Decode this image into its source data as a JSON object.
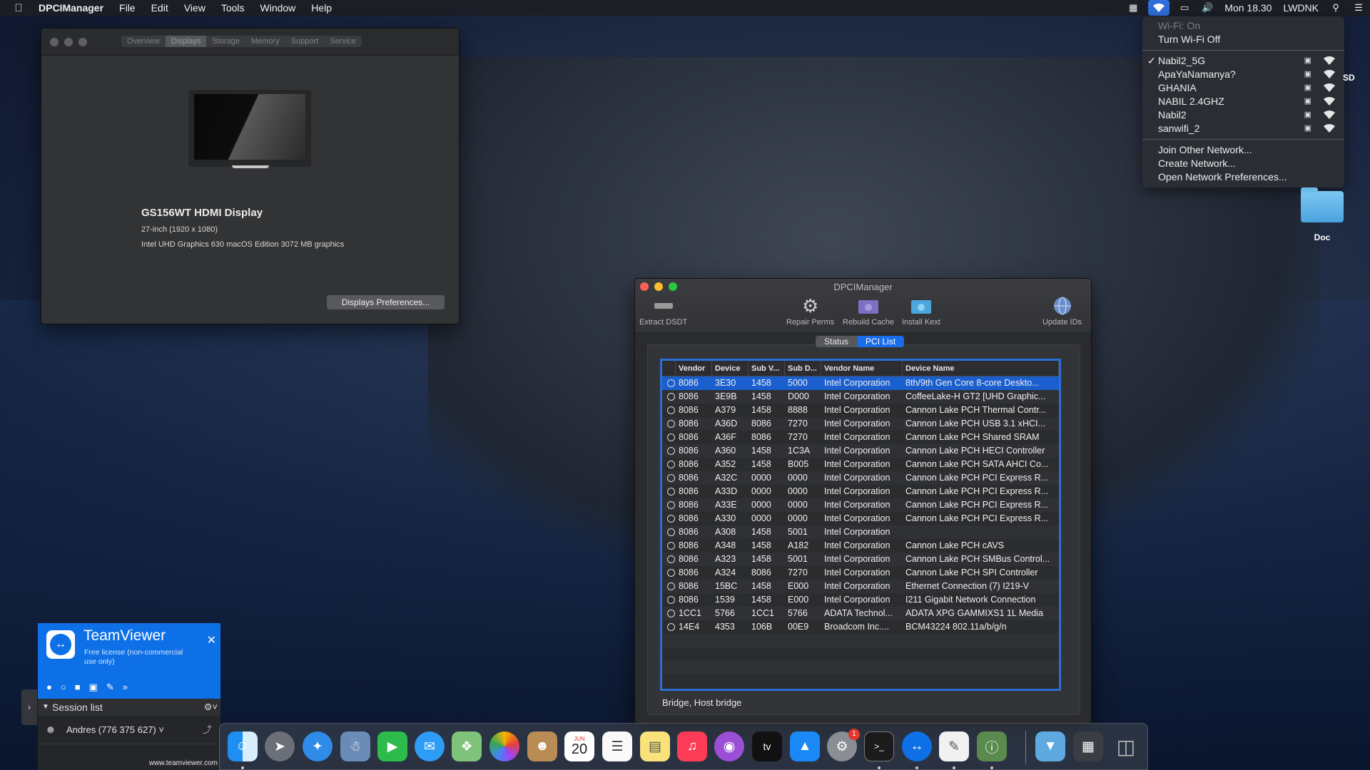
{
  "menubar": {
    "app_name": "DPCIManager",
    "menus": [
      "File",
      "Edit",
      "View",
      "Tools",
      "Window",
      "Help"
    ],
    "clock": "Mon 18.30",
    "user": "LWDNK"
  },
  "wifi_menu": {
    "status": "Wi-Fi: On",
    "toggle": "Turn Wi-Fi Off",
    "networks": [
      "Nabil2_5G",
      "ApaYaNamanya?",
      "GHANIA",
      "NABIL 2.4GHZ",
      "Nabil2",
      "sanwifi_2"
    ],
    "connected_network": "Nabil2_5G",
    "actions": [
      "Join Other Network...",
      "Create Network...",
      "Open Network Preferences..."
    ]
  },
  "desktop": {
    "folder_label": "Doc",
    "partial_label": "SD"
  },
  "about": {
    "tabs": [
      "Overview",
      "Displays",
      "Storage",
      "Memory",
      "Support",
      "Service"
    ],
    "active_tab": "Displays",
    "display_name": "GS156WT HDMI Display",
    "display_size": "27-inch (1920 x 1080)",
    "graphics": "Intel UHD Graphics 630 macOS Edition 3072 MB graphics",
    "button": "Displays Preferences..."
  },
  "dpci": {
    "title": "DPCIManager",
    "toolbar": [
      {
        "label": "Extract DSDT",
        "icon": "chip-icon"
      },
      {
        "label": "Repair Perms",
        "icon": "gear-icon"
      },
      {
        "label": "Rebuild Cache",
        "icon": "folder-gear-icon"
      },
      {
        "label": "Install Kext",
        "icon": "folder-kext-icon"
      },
      {
        "label": "Update IDs",
        "icon": "globe-icon"
      }
    ],
    "tabs": [
      "Status",
      "PCI List"
    ],
    "active_tab": "PCI List",
    "columns": [
      "Vendor",
      "Device",
      "Sub V...",
      "Sub D...",
      "Vendor Name",
      "Device Name"
    ],
    "rows": [
      [
        "8086",
        "3E30",
        "1458",
        "5000",
        "Intel Corporation",
        "8th/9th Gen Core 8-core Deskto..."
      ],
      [
        "8086",
        "3E9B",
        "1458",
        "D000",
        "Intel Corporation",
        "CoffeeLake-H GT2 [UHD Graphic..."
      ],
      [
        "8086",
        "A379",
        "1458",
        "8888",
        "Intel Corporation",
        "Cannon Lake PCH Thermal Contr..."
      ],
      [
        "8086",
        "A36D",
        "8086",
        "7270",
        "Intel Corporation",
        "Cannon Lake PCH USB 3.1 xHCI..."
      ],
      [
        "8086",
        "A36F",
        "8086",
        "7270",
        "Intel Corporation",
        "Cannon Lake PCH Shared SRAM"
      ],
      [
        "8086",
        "A360",
        "1458",
        "1C3A",
        "Intel Corporation",
        "Cannon Lake PCH HECI Controller"
      ],
      [
        "8086",
        "A352",
        "1458",
        "B005",
        "Intel Corporation",
        "Cannon Lake PCH SATA AHCI Co..."
      ],
      [
        "8086",
        "A32C",
        "0000",
        "0000",
        "Intel Corporation",
        "Cannon Lake PCH PCI Express R..."
      ],
      [
        "8086",
        "A33D",
        "0000",
        "0000",
        "Intel Corporation",
        "Cannon Lake PCH PCI Express R..."
      ],
      [
        "8086",
        "A33E",
        "0000",
        "0000",
        "Intel Corporation",
        "Cannon Lake PCH PCI Express R..."
      ],
      [
        "8086",
        "A330",
        "0000",
        "0000",
        "Intel Corporation",
        "Cannon Lake PCH PCI Express R..."
      ],
      [
        "8086",
        "A308",
        "1458",
        "5001",
        "Intel Corporation",
        ""
      ],
      [
        "8086",
        "A348",
        "1458",
        "A182",
        "Intel Corporation",
        "Cannon Lake PCH cAVS"
      ],
      [
        "8086",
        "A323",
        "1458",
        "5001",
        "Intel Corporation",
        "Cannon Lake PCH SMBus Control..."
      ],
      [
        "8086",
        "A324",
        "8086",
        "7270",
        "Intel Corporation",
        "Cannon Lake PCH SPI Controller"
      ],
      [
        "8086",
        "15BC",
        "1458",
        "E000",
        "Intel Corporation",
        "Ethernet Connection (7) I219-V"
      ],
      [
        "8086",
        "1539",
        "1458",
        "E000",
        "Intel Corporation",
        "I211 Gigabit Network Connection"
      ],
      [
        "1CC1",
        "5766",
        "1CC1",
        "5766",
        "ADATA Technol...",
        "ADATA XPG GAMMIXS1 1L Media"
      ],
      [
        "14E4",
        "4353",
        "106B",
        "00E9",
        "Broadcom Inc....",
        "BCM43224 802.11a/b/g/n"
      ]
    ],
    "selected_row": 0,
    "footer": "Bridge, Host bridge"
  },
  "teamviewer": {
    "brand": "TeamViewer",
    "license": "Free license (non-commercial use only)",
    "session_list": "Session list",
    "contact": "Andres (776 375 627)",
    "url": "www.teamviewer.com"
  },
  "dock": {
    "apps": [
      "Finder",
      "Launchpad",
      "Safari",
      "Preview",
      "FaceTime",
      "Messages",
      "Maps",
      "Photos",
      "Contacts",
      "Calendar",
      "Reminders",
      "Notes",
      "Music",
      "Podcasts",
      "TV",
      "App Store",
      "System Preferences",
      "Terminal",
      "TeamViewer",
      "TextEdit",
      "DPCIManager",
      "Downloads",
      "Screenshot",
      "Trash"
    ],
    "calendar_month": "JUN",
    "calendar_day": "20",
    "tv_label": "tv",
    "prefs_badge": "1"
  }
}
